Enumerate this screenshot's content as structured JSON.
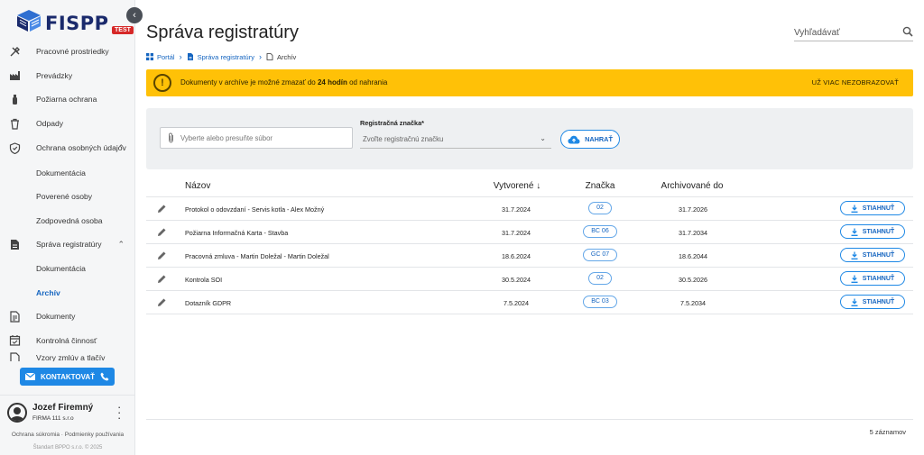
{
  "app": {
    "logo_text": "FISPP",
    "env_badge": "TEST"
  },
  "sidebar": {
    "items": [
      {
        "label": "Pracovné prostriedky",
        "icon": "tools-icon"
      },
      {
        "label": "Prevádzky",
        "icon": "factory-icon"
      },
      {
        "label": "Požiarna ochrana",
        "icon": "fire-extinguisher-icon"
      },
      {
        "label": "Odpady",
        "icon": "trash-icon"
      },
      {
        "label": "Ochrana osobných údajov",
        "icon": "shield-icon",
        "expanded": true
      },
      {
        "label": "Dokumentácia",
        "sub": true
      },
      {
        "label": "Poverené osoby",
        "sub": true
      },
      {
        "label": "Zodpovedná osoba",
        "sub": true
      },
      {
        "label": "Správa registratúry",
        "icon": "registry-icon",
        "expanded": true
      },
      {
        "label": "Dokumentácia",
        "sub": true
      },
      {
        "label": "Archív",
        "sub": true,
        "active": true
      },
      {
        "label": "Dokumenty",
        "icon": "document-icon"
      },
      {
        "label": "Kontrolná činnosť",
        "icon": "calendar-check-icon"
      },
      {
        "label": "Vzory zmlúv a tlačív",
        "icon": "template-icon"
      }
    ],
    "contact_label": "KONTAKTOVAŤ",
    "user": {
      "name": "Jozef Firemný",
      "company": "FIRMA 111 s.r.o"
    },
    "footer_links": "Ochrana súkromia · Podmienky používania",
    "copyright": "Štandart BPPO s.r.o. © 2025"
  },
  "header": {
    "title": "Správa registratúry",
    "search_placeholder": "Vyhľadávať"
  },
  "breadcrumb": {
    "portal": "Portál",
    "registry": "Správa registratúry",
    "current": "Archív"
  },
  "alert": {
    "text_before": "Dokumenty v archíve je možné zmazať do ",
    "text_bold": "24 hodín",
    "text_after": " od nahrania",
    "dismiss_label": "UŽ VIAC NEZOBRAZOVAŤ",
    "color": "#ffc107"
  },
  "upload": {
    "file_placeholder": "Vyberte alebo presuňte súbor",
    "reg_label": "Registračná značka*",
    "reg_placeholder": "Zvoľte registračnú značku",
    "upload_label": "NAHRAŤ"
  },
  "table": {
    "headers": {
      "name": "Názov",
      "created": "Vytvorené",
      "mark": "Značka",
      "archived": "Archivované do"
    },
    "download_label": "STIAHNUŤ",
    "rows": [
      {
        "name": "Protokol o odovzdaní - Servis kotla - Alex Možný",
        "created": "31.7.2024",
        "mark": "02",
        "archived": "31.7.2026"
      },
      {
        "name": "Požiarna Informačná Karta - Stavba",
        "created": "31.7.2024",
        "mark": "BC 06",
        "archived": "31.7.2034"
      },
      {
        "name": "Pracovná zmluva - Martin Doležal - Martin Doležal",
        "created": "18.6.2024",
        "mark": "GC 07",
        "archived": "18.6.2044"
      },
      {
        "name": "Kontrola SOI",
        "created": "30.5.2024",
        "mark": "02",
        "archived": "30.5.2026"
      },
      {
        "name": "Dotazník GDPR",
        "created": "7.5.2024",
        "mark": "BC 03",
        "archived": "7.5.2034"
      }
    ],
    "records_count": "5 záznamov"
  },
  "colors": {
    "primary": "#1e88e5",
    "link": "#1565c0",
    "brand": "#1a2a6c",
    "badge_red": "#d62828"
  }
}
